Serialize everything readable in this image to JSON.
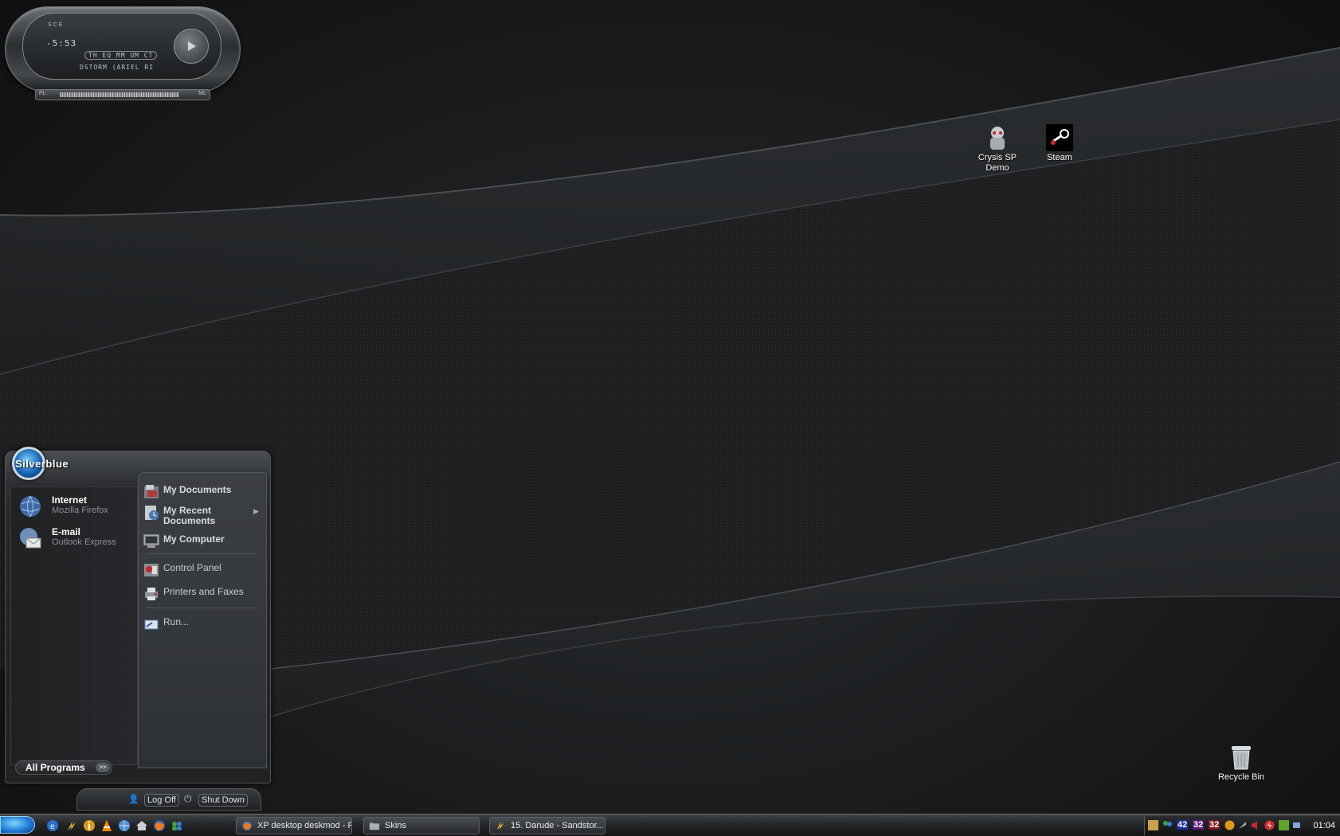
{
  "player": {
    "time": "-5:53",
    "eq_label": "TH EQ MM UM CT",
    "track_label": "DSTORM (ARIEL RI",
    "pl_left": "PL",
    "ml_right": "ML",
    "top_letters": "S C E"
  },
  "desktop_icons": [
    {
      "name": "crysis",
      "label": "Crysis SP Demo",
      "icon": "crysis-icon"
    },
    {
      "name": "steam",
      "label": "Steam",
      "icon": "steam-icon"
    },
    {
      "name": "recycle",
      "label": "Recycle Bin",
      "icon": "recycle-bin-icon"
    }
  ],
  "start_menu": {
    "username": "Silverblue",
    "pinned": [
      {
        "title": "Internet",
        "subtitle": "Mozilla Firefox",
        "icon": "internet-icon"
      },
      {
        "title": "E-mail",
        "subtitle": "Outlook Express",
        "icon": "email-icon"
      }
    ],
    "places": [
      {
        "label": "My Documents",
        "icon": "my-documents-icon"
      },
      {
        "label": "My Recent Documents",
        "icon": "recent-documents-icon"
      },
      {
        "label": "My Computer",
        "icon": "my-computer-icon"
      },
      {
        "label": "Control Panel",
        "icon": "control-panel-icon"
      },
      {
        "label": "Printers and Faxes",
        "icon": "printers-icon"
      },
      {
        "label": "Run...",
        "icon": "run-icon"
      }
    ],
    "all_programs": "All Programs",
    "all_programs_arrow": ">>",
    "log_off": "Log Off",
    "shut_down": "Shut Down"
  },
  "taskbar": {
    "tasks": [
      {
        "label": "XP desktop deskmod - F...",
        "icon": "firefox-icon"
      },
      {
        "label": "Skins",
        "icon": "folder-icon"
      },
      {
        "label": "15. Darude - Sandstor...",
        "icon": "winamp-icon"
      }
    ],
    "tray_numbers": [
      "42",
      "32",
      "32"
    ],
    "clock": "01:04"
  },
  "colors": {
    "accent_blue": "#1a74d2",
    "tray_num_1": "#3a66ff",
    "tray_num_2": "#d04cff",
    "tray_num_3": "#ff4040"
  }
}
